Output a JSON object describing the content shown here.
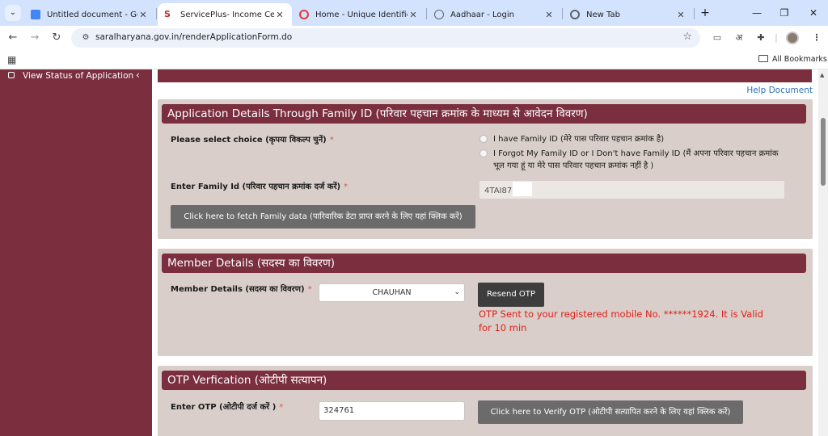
{
  "browser": {
    "tabs": [
      {
        "title": "Untitled document - Google",
        "favicon_color": "#4285f4"
      },
      {
        "title": "ServicePlus- Income Certific",
        "favicon_color": "#c62828"
      },
      {
        "title": "Home - Unique Identification",
        "favicon_color": "#e53935"
      },
      {
        "title": "Aadhaar - Login",
        "favicon_color": "#5f6368"
      },
      {
        "title": "New Tab",
        "favicon_color": "#5f6368"
      }
    ],
    "active_tab": 1,
    "url": "saralharyana.gov.in/renderApplicationForm.do",
    "translate_label": "अ",
    "all_bookmarks": "All Bookmarks"
  },
  "sidebar": {
    "item": "View Status of Application"
  },
  "page": {
    "help_link": "Help Document",
    "family_section": {
      "title": "Application Details Through Family ID (परिवार पहचान क्रमांक के माध्यम से आवेदन विवरण)",
      "choice_label": "Please select choice (कृपया विकल्प चुनें)",
      "options": [
        "I have Family ID (मेरे पास परिवार पहचान क्रमांक है)",
        "I Forgot My Family ID or I Don't have Family ID (मैं अपना परिवार पहचान क्रमांक भूल गया हूं या मेरे पास परिवार पहचान क्रमांक नहीं है )"
      ],
      "family_id_label": "Enter Family Id (परिवार पहचान क्रमांक दर्ज करें)",
      "family_id_value": "4TAI87",
      "fetch_button": "Click here to fetch Family data (पारिवारिक डेटा प्राप्त करने के लिए यहां क्लिक करें)"
    },
    "member_section": {
      "title": "Member Details (सदस्य का विवरण)",
      "member_label": "Member Details (सदस्य का विवरण)",
      "member_selected": "CHAUHAN",
      "resend_button": "Resend OTP",
      "otp_message": "OTP Sent to your registered mobile No. ******1924. It is Valid for 10 min"
    },
    "otp_section": {
      "title": "OTP Verfication (ओटीपी सत्यापन)",
      "otp_label": "Enter OTP (ओटीपी दर्ज करें )",
      "otp_value": "324761",
      "verify_button": "Click here to Verify OTP (ओटीपी सत्यापित करने के लिए यहां क्लिक करें)"
    },
    "required_mark": "*"
  },
  "colors": {
    "brand_maroon": "#7a2e3e",
    "panel_bg": "#d9cec9",
    "error_red": "#e0201b",
    "link_blue": "#2d72b8"
  }
}
